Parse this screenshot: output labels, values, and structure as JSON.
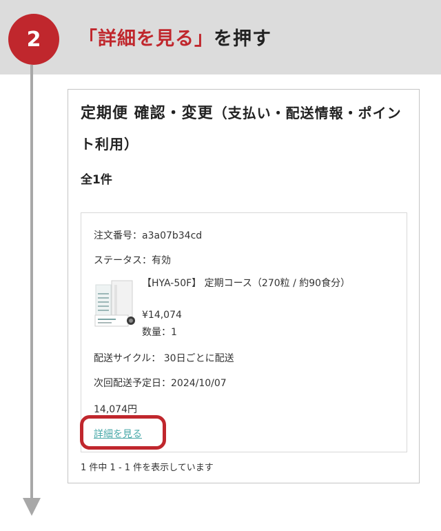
{
  "step": {
    "number": "2",
    "title_accent": "「詳細を見る」",
    "title_rest": "を押す"
  },
  "panel": {
    "title_main": "定期便 確認・変更",
    "title_paren": "（支払い・配送情報・ポイント利用）",
    "count": "全1件"
  },
  "order": {
    "order_number": "注文番号：a3a07b34cd",
    "status": "ステータス：有効",
    "product_name": "【HYA-50F】 定期コース（270粒 / 約90食分）",
    "price": "¥14,074",
    "quantity": "数量：1",
    "cycle": "配送サイクル： 30日ごとに配送",
    "next_delivery": "次回配送予定日：2024/10/07",
    "total": "14,074円",
    "detail_link": "詳細を見る",
    "thumbnail_icon": "product-package-image"
  },
  "pager": "1 件中 1 - 1 件を表示しています",
  "colors": {
    "accent": "#c0272d",
    "header_bg": "#dcdcdc",
    "link": "#4aa9a9",
    "arrow": "#a8a8a8"
  }
}
